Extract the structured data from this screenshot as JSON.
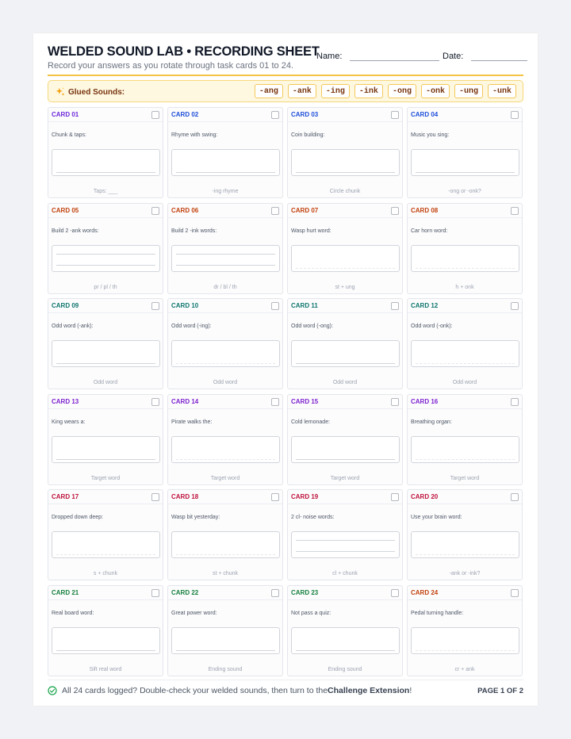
{
  "header": {
    "title": "WELDED SOUND LAB • RECORDING SHEET",
    "subtitle": "Record your answers as you rotate through task cards 01 to 24.",
    "name_label": "Name:",
    "date_label": "Date:"
  },
  "glued": {
    "label": "Glued Sounds:",
    "icon": "sparkle-icon",
    "chips": [
      "-ang",
      "-ank",
      "-ing",
      "-ink",
      "-ong",
      "-onk",
      "-ung",
      "-unk"
    ]
  },
  "colors": {
    "accent": "#f3c344",
    "purple": "#6d28d9",
    "blue": "#1d4ed8",
    "orange": "#c2410c",
    "teal": "#0f766e",
    "violet": "#7e22ce",
    "crimson": "#be123c",
    "green": "#15803d"
  },
  "cards": [
    {
      "label": "CARD 01",
      "prompt": "Chunk & taps:",
      "hint": "Taps: ___",
      "color": "#6d28d9",
      "lines": 1
    },
    {
      "label": "CARD 02",
      "prompt": "Rhyme with swing:",
      "hint": "-ing rhyme",
      "color": "#1d4ed8",
      "lines": 1
    },
    {
      "label": "CARD 03",
      "prompt": "Coin building:",
      "hint": "Circle chunk",
      "color": "#1d4ed8",
      "lines": 1
    },
    {
      "label": "CARD 04",
      "prompt": "Music you sing:",
      "hint": "-ong or -onk?",
      "color": "#1d4ed8",
      "lines": 1
    },
    {
      "label": "CARD 05",
      "prompt": "Build 2 -ank words:",
      "hint": "pr / pl / th",
      "color": "#c2410c",
      "lines": 2
    },
    {
      "label": "CARD 06",
      "prompt": "Build 2 -ink words:",
      "hint": "dr / bl / th",
      "color": "#c2410c",
      "lines": 2
    },
    {
      "label": "CARD 07",
      "prompt": "Wasp hurt word:",
      "hint": "st + ung",
      "color": "#c2410c",
      "lines": 0
    },
    {
      "label": "CARD 08",
      "prompt": "Car horn word:",
      "hint": "h + onk",
      "color": "#c2410c",
      "lines": 0
    },
    {
      "label": "CARD 09",
      "prompt": "Odd word (-ank):",
      "hint": "Odd word",
      "color": "#0f766e",
      "lines": 1
    },
    {
      "label": "CARD 10",
      "prompt": "Odd word (-ing):",
      "hint": "Odd word",
      "color": "#0f766e",
      "lines": 0
    },
    {
      "label": "CARD 11",
      "prompt": "Odd word (-ong):",
      "hint": "Odd word",
      "color": "#0f766e",
      "lines": 1
    },
    {
      "label": "CARD 12",
      "prompt": "Odd word (-onk):",
      "hint": "Odd word",
      "color": "#0f766e",
      "lines": 0
    },
    {
      "label": "CARD 13",
      "prompt": "King wears a:",
      "hint": "Target word",
      "color": "#7e22ce",
      "lines": 1
    },
    {
      "label": "CARD 14",
      "prompt": "Pirate walks the:",
      "hint": "Target word",
      "color": "#7e22ce",
      "lines": 0
    },
    {
      "label": "CARD 15",
      "prompt": "Cold lemonade:",
      "hint": "Target word",
      "color": "#7e22ce",
      "lines": 1
    },
    {
      "label": "CARD 16",
      "prompt": "Breathing organ:",
      "hint": "Target word",
      "color": "#7e22ce",
      "lines": 0
    },
    {
      "label": "CARD 17",
      "prompt": "Dropped down deep:",
      "hint": "s + chunk",
      "color": "#be123c",
      "lines": 0
    },
    {
      "label": "CARD 18",
      "prompt": "Wasp bit yesterday:",
      "hint": "st + chunk",
      "color": "#be123c",
      "lines": 0
    },
    {
      "label": "CARD 19",
      "prompt": "2 cl- noise words:",
      "hint": "cl + chunk",
      "color": "#be123c",
      "lines": 2
    },
    {
      "label": "CARD 20",
      "prompt": "Use your brain word:",
      "hint": "-ank or -ink?",
      "color": "#be123c",
      "lines": 0
    },
    {
      "label": "CARD 21",
      "prompt": "Real board word:",
      "hint": "Sift real word",
      "color": "#15803d",
      "lines": 1
    },
    {
      "label": "CARD 22",
      "prompt": "Great power word:",
      "hint": "Ending sound",
      "color": "#15803d",
      "lines": 1
    },
    {
      "label": "CARD 23",
      "prompt": "Not pass a quiz:",
      "hint": "Ending sound",
      "color": "#15803d",
      "lines": 1
    },
    {
      "label": "CARD 24",
      "prompt": "Pedal turning handle:",
      "hint": "cr + ank",
      "color": "#c2410c",
      "lines": 0
    }
  ],
  "footer": {
    "icon": "check-circle-icon",
    "text_before": "All 24 cards logged? Double-check your welded sounds, then turn to the ",
    "bold": "Challenge Extension",
    "text_after": "!",
    "page": "PAGE 1 OF 2"
  }
}
